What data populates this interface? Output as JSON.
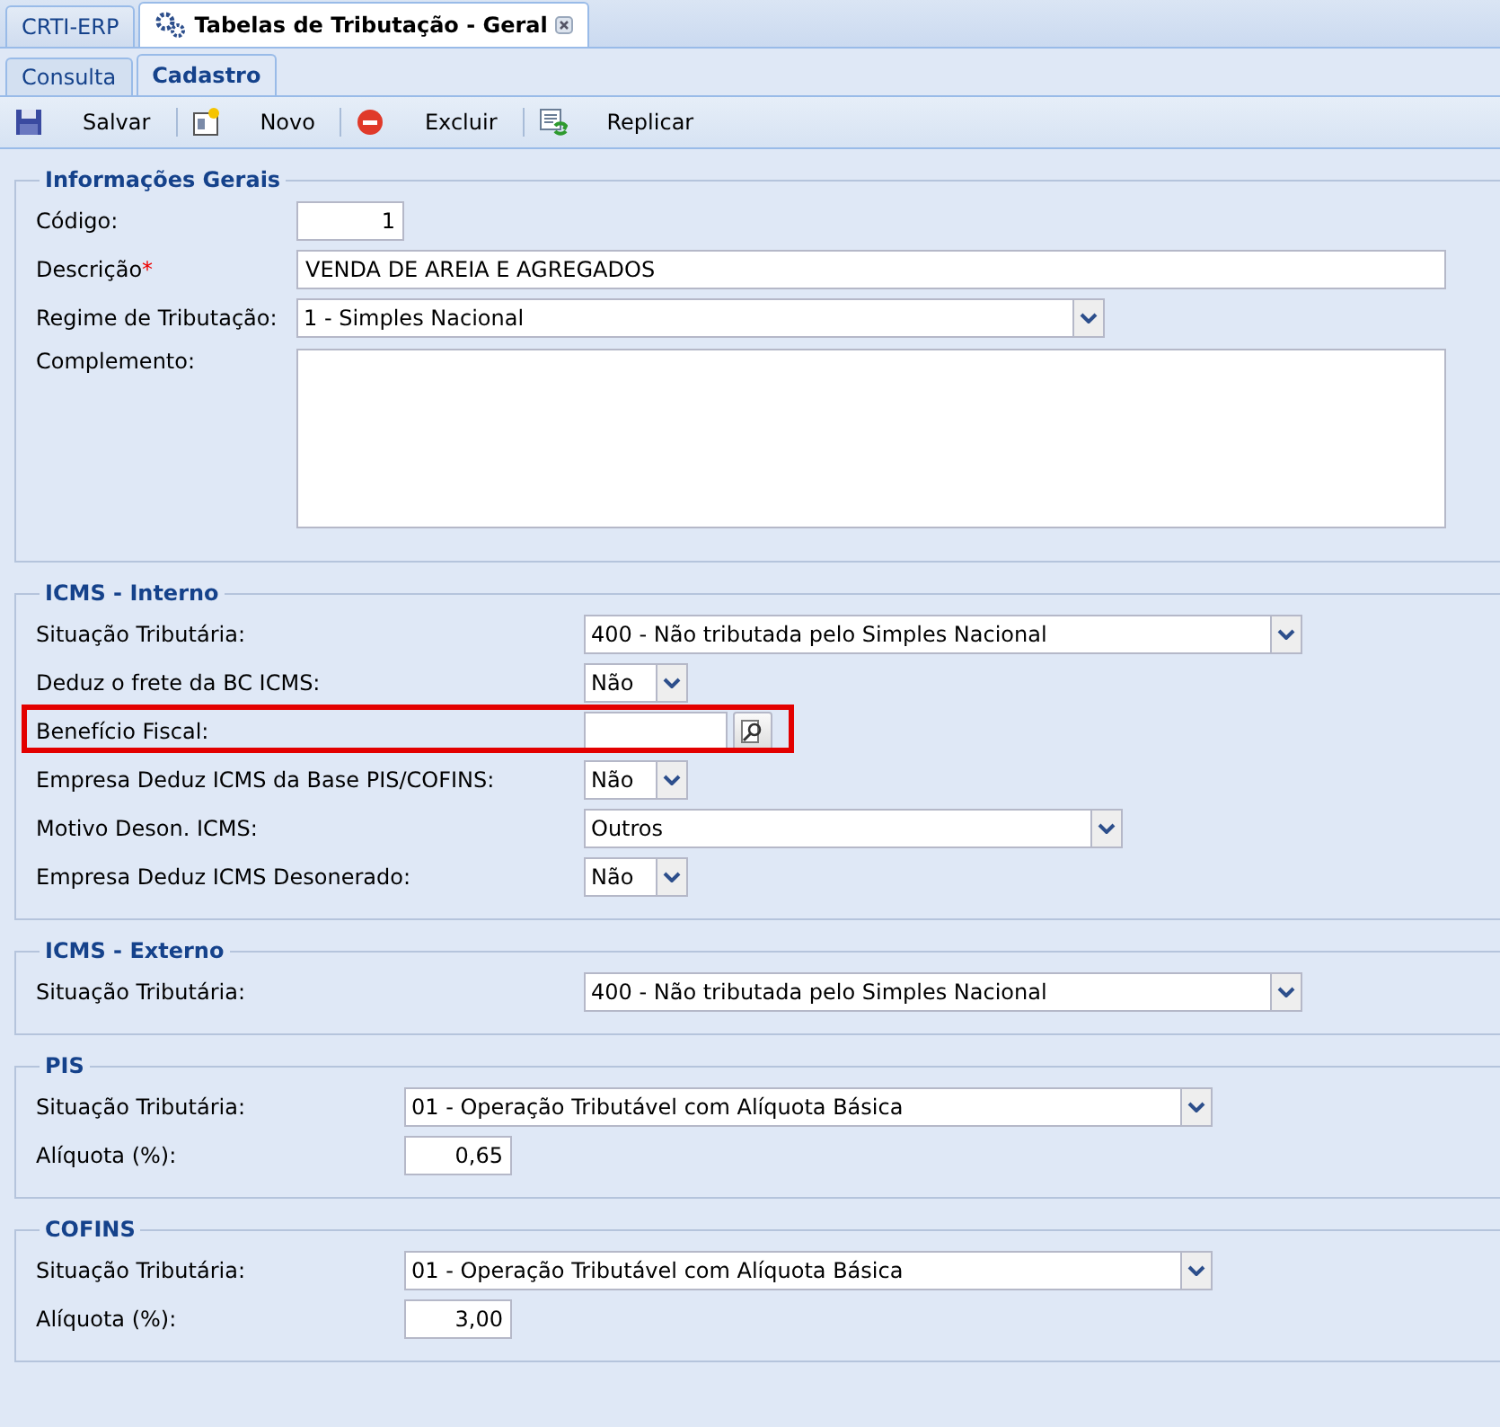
{
  "window_tabs": [
    {
      "label": "CRTI-ERP",
      "selected": false,
      "closable": false,
      "icon": false
    },
    {
      "label": "Tabelas de Tributação - Geral",
      "selected": true,
      "closable": true,
      "icon": true
    }
  ],
  "tabs": [
    {
      "label": "Consulta",
      "selected": false
    },
    {
      "label": "Cadastro",
      "selected": true
    }
  ],
  "toolbar": [
    {
      "kind": "save",
      "label": "Salvar"
    },
    {
      "kind": "new",
      "label": "Novo"
    },
    {
      "kind": "delete",
      "label": "Excluir"
    },
    {
      "kind": "copy",
      "label": "Replicar"
    }
  ],
  "sections": [
    {
      "title": "Informações Gerais",
      "fields": [
        {
          "kind": "number",
          "label": "Código:",
          "value": "1"
        },
        {
          "kind": "text",
          "label": "Descrição",
          "required_mark": "*",
          "value": "VENDA DE AREIA E AGREGADOS"
        },
        {
          "kind": "select",
          "label": "Regime de Tributação:",
          "value": "1 - Simples Nacional"
        },
        {
          "kind": "textarea",
          "label": "Complemento:"
        }
      ]
    },
    {
      "title": "ICMS - Interno",
      "fields": [
        {
          "kind": "select",
          "label": "Situação Tributária:",
          "value": "400 - Não tributada pelo Simples Nacional"
        },
        {
          "kind": "select",
          "label": "Deduz o frete da BC ICMS:",
          "value": "Não"
        },
        {
          "kind": "lookup",
          "label": "Benefício Fiscal:",
          "highlighted": true
        },
        {
          "kind": "select",
          "label": "Empresa Deduz ICMS da Base PIS/COFINS:",
          "value": "Não"
        },
        {
          "kind": "select",
          "label": "Motivo Deson. ICMS:",
          "value": "Outros"
        },
        {
          "kind": "select",
          "label": "Empresa Deduz ICMS Desonerado:",
          "value": "Não"
        }
      ]
    },
    {
      "title": "ICMS - Externo",
      "fields": [
        {
          "kind": "select",
          "label": "Situação Tributária:",
          "value": "400 - Não tributada pelo Simples Nacional"
        }
      ]
    },
    {
      "title": "PIS",
      "fields": [
        {
          "kind": "select",
          "label": "Situação Tributária:",
          "value": "01 - Operação Tributável com Alíquota Básica"
        },
        {
          "kind": "number",
          "label": "Alíquota (%):",
          "value": "0,65"
        }
      ]
    },
    {
      "title": "COFINS",
      "fields": [
        {
          "kind": "select",
          "label": "Situação Tributária:",
          "value": "01 - Operação Tributável com Alíquota Básica"
        },
        {
          "kind": "number",
          "label": "Alíquota (%):",
          "value": "3,00"
        }
      ]
    }
  ]
}
